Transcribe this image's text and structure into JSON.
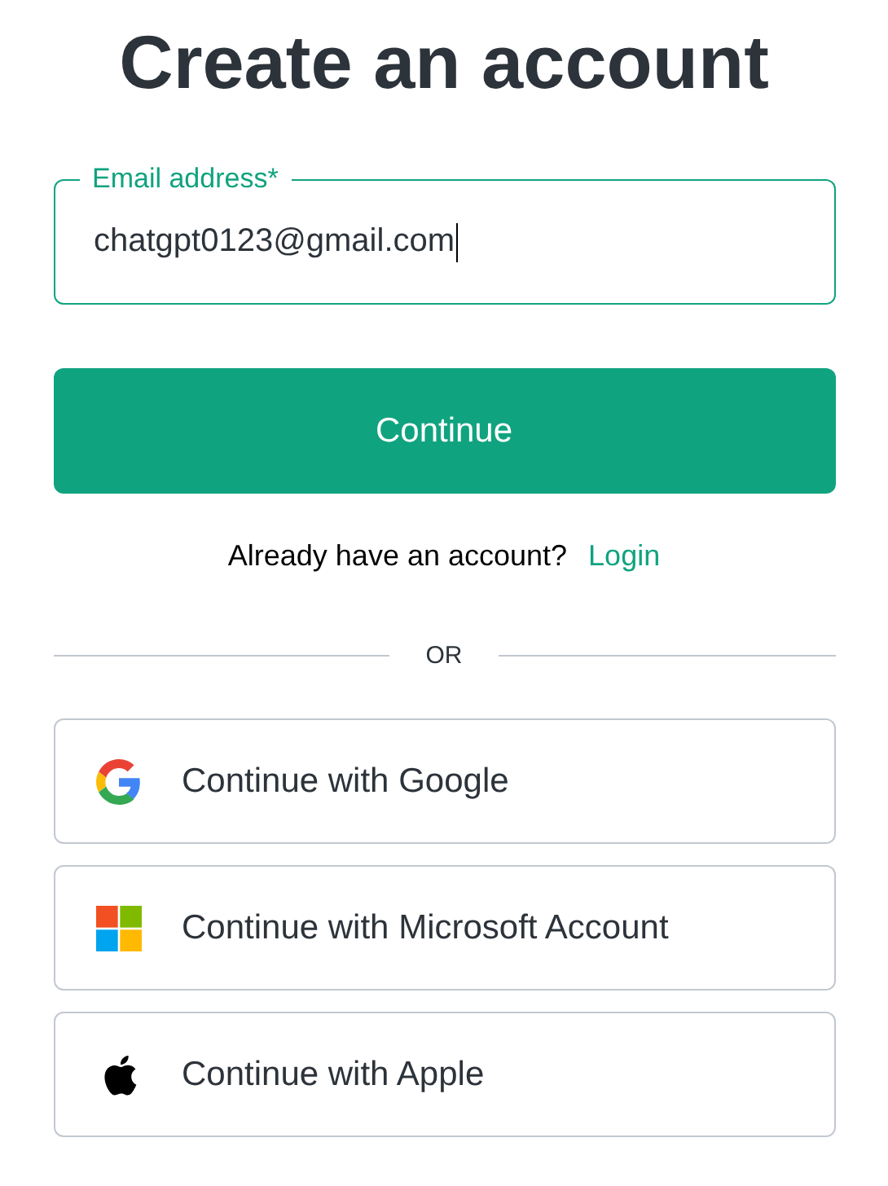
{
  "title": "Create an account",
  "email_field": {
    "label": "Email address*",
    "value": "chatgpt0123@gmail.com",
    "focused": true
  },
  "continue_button": "Continue",
  "login_prompt": {
    "text": "Already have an account?",
    "link": "Login"
  },
  "divider": "OR",
  "social_buttons": [
    {
      "kind": "google",
      "label": "Continue with Google"
    },
    {
      "kind": "microsoft",
      "label": "Continue with Microsoft Account"
    },
    {
      "kind": "apple",
      "label": "Continue with Apple"
    }
  ]
}
